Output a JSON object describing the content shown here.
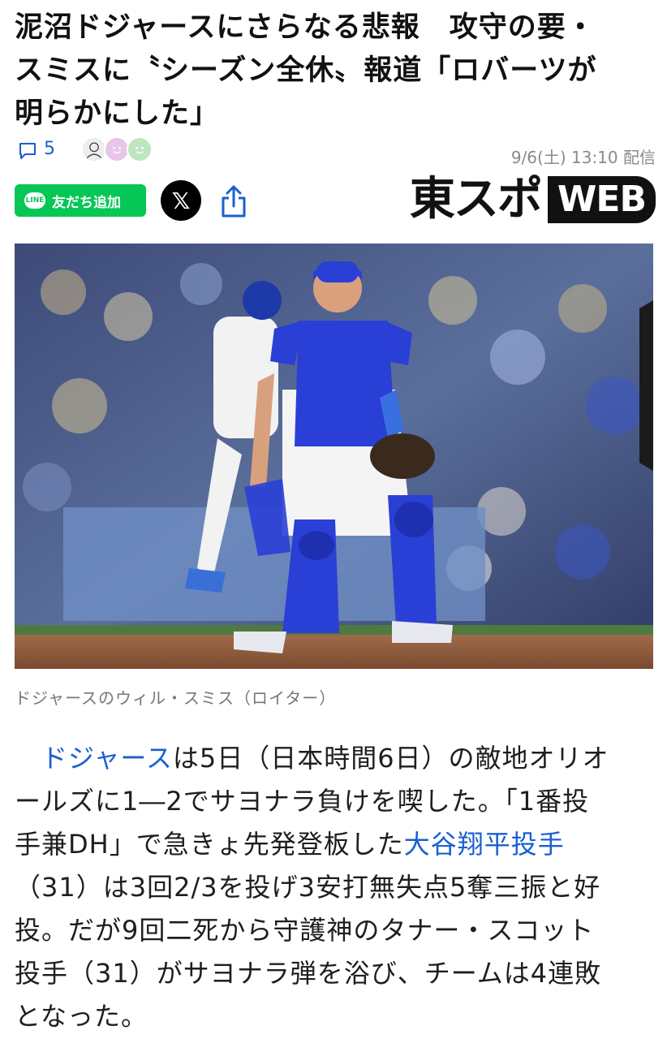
{
  "article": {
    "headline_lines": [
      "泥沼ドジャースにさらなる悲報　攻守の要・",
      "スミスに〝シーズン全休〟報道「ロバーツが",
      "明らかにした」"
    ],
    "comment_count": "5",
    "timestamp": "9/6(土) 13:10 配信",
    "line_button_label": "友だち追加",
    "line_badge": "LINE",
    "x_button_label": "𝕏",
    "publisher_logo_main": "東スポ",
    "publisher_logo_badge": "WEB",
    "photo_caption": "ドジャースのウィル・スミス（ロイター）",
    "body_lines": [
      {
        "parts": [
          {
            "text": "　"
          },
          {
            "text": "ドジャース",
            "link": true
          },
          {
            "text": "は5日（日本時間6日）の敵地オリオ"
          }
        ]
      },
      {
        "parts": [
          {
            "text": "ールズに1―2でサヨナラ負けを喫した。「1番投"
          }
        ]
      },
      {
        "parts": [
          {
            "text": "手兼DH」で急きょ先発登板した"
          },
          {
            "text": "大谷翔平投手",
            "link": true
          }
        ]
      },
      {
        "parts": [
          {
            "text": "（31）は3回2/3を投げ3安打無失点5奪三振と好"
          }
        ]
      },
      {
        "parts": [
          {
            "text": "投。だが9回二死から守護神のタナー・スコット"
          }
        ]
      },
      {
        "parts": [
          {
            "text": "投手（31）がサヨナラ弾を浴び、チームは4連敗"
          }
        ]
      },
      {
        "parts": [
          {
            "text": "となった。"
          }
        ]
      }
    ]
  },
  "colors": {
    "link": "#1a5fd1",
    "line_green": "#06c755",
    "catcher_gear": "#2a3fd6"
  },
  "icons": [
    "comment-icon",
    "line-icon",
    "x-logo-icon",
    "share-icon"
  ]
}
